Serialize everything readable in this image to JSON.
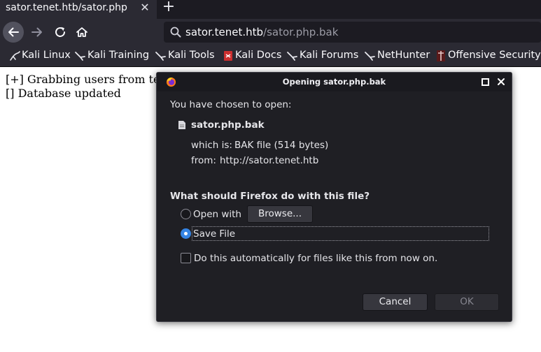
{
  "browser": {
    "tab_title": "sator.tenet.htb/sator.php",
    "tab_close": "✕",
    "new_tab": "+",
    "url_host": "sator.tenet.htb",
    "url_path": "/sator.php.bak",
    "bookmarks": [
      {
        "label": "Kali Linux",
        "icon": "kali-dragon-icon"
      },
      {
        "label": "Kali Training",
        "icon": "kali-dragon-icon"
      },
      {
        "label": "Kali Tools",
        "icon": "kali-dragon-icon"
      },
      {
        "label": "Kali Docs",
        "icon": "kali-docs-icon"
      },
      {
        "label": "Kali Forums",
        "icon": "kali-dragon-icon"
      },
      {
        "label": "NetHunter",
        "icon": "kali-dragon-icon"
      },
      {
        "label": "Offensive Security",
        "icon": "offsec-icon"
      }
    ]
  },
  "page": {
    "lines": [
      "[+] Grabbing users from te",
      "[] Database updated"
    ]
  },
  "dialog": {
    "title": "Opening sator.php.bak",
    "intro": "You have chosen to open:",
    "file_name": "sator.php.bak",
    "which_is_label": "which is:",
    "which_is_value": "BAK file (514 bytes)",
    "from_label": "from:",
    "from_value": "http://sator.tenet.htb",
    "question": "What should Firefox do with this file?",
    "open_with_label": "Open with",
    "browse_label": "Browse...",
    "save_file_label": "Save File",
    "save_file_selected": true,
    "auto_label": "Do this automatically for files like this from now on.",
    "auto_checked": false,
    "cancel_label": "Cancel",
    "ok_label": "OK",
    "ok_disabled": true
  },
  "colors": {
    "chrome_dark": "#1c1b22",
    "chrome": "#2b2a33",
    "dialog_bg": "#1f1f24",
    "accent_blue": "#3584e4"
  }
}
